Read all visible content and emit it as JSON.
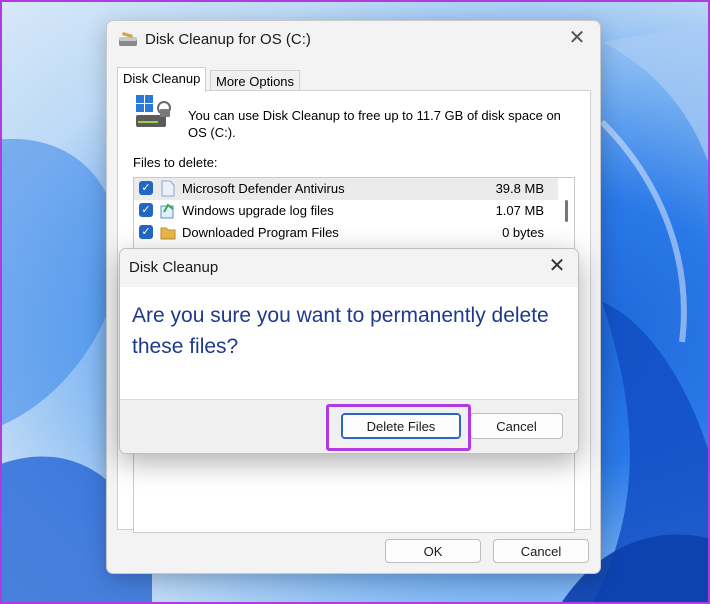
{
  "main_window": {
    "title": "Disk Cleanup for OS (C:)",
    "app_icon": "disk-cleanup-icon",
    "close_icon": "close-icon",
    "tabs": [
      {
        "label": "Disk Cleanup",
        "active": true
      },
      {
        "label": "More Options",
        "active": false
      }
    ],
    "info_text": "You can use Disk Cleanup to free up to 11.7 GB of disk space on OS (C:).",
    "files_label": "Files to delete:",
    "files": [
      {
        "name": "Microsoft Defender Antivirus",
        "size": "39.8 MB",
        "checked": true,
        "icon": "file-icon"
      },
      {
        "name": "Windows upgrade log files",
        "size": "1.07 MB",
        "checked": true,
        "icon": "log-files-icon"
      },
      {
        "name": "Downloaded Program Files",
        "size": "0 bytes",
        "checked": true,
        "icon": "folder-icon"
      }
    ],
    "ok_label": "OK",
    "cancel_label": "Cancel"
  },
  "confirm_dialog": {
    "title": "Disk Cleanup",
    "question": "Are you sure you want to permanently delete these files?",
    "delete_label": "Delete Files",
    "cancel_label": "Cancel"
  },
  "colors": {
    "accent": "#2367c5",
    "question_text": "#1f3a8c",
    "highlight": "#b03be0"
  }
}
